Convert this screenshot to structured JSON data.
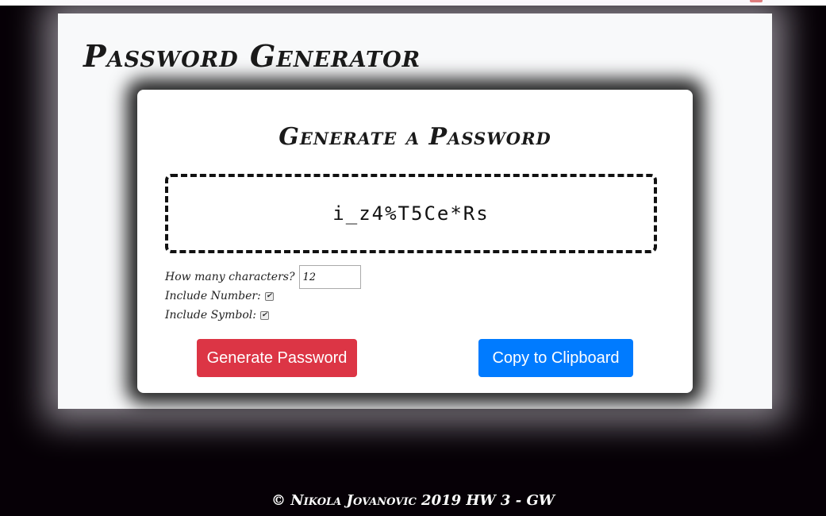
{
  "app": {
    "title": "Password Generator"
  },
  "card": {
    "title": "Generate a Password",
    "password": "i_z4%T5Ce*Rs"
  },
  "options": {
    "length_label": "How many characters?",
    "length_value": "12",
    "number_label": "Include Number:",
    "number_checked": true,
    "symbol_label": "Include Symbol:",
    "symbol_checked": true
  },
  "buttons": {
    "generate_label": "Generate Password",
    "copy_label": "Copy to Clipboard"
  },
  "footer": {
    "text": "© Nikola Jovanovic 2019 HW 3 - GW"
  },
  "colors": {
    "generate": "#dc3545",
    "copy": "#007bff",
    "background": "#060006"
  }
}
